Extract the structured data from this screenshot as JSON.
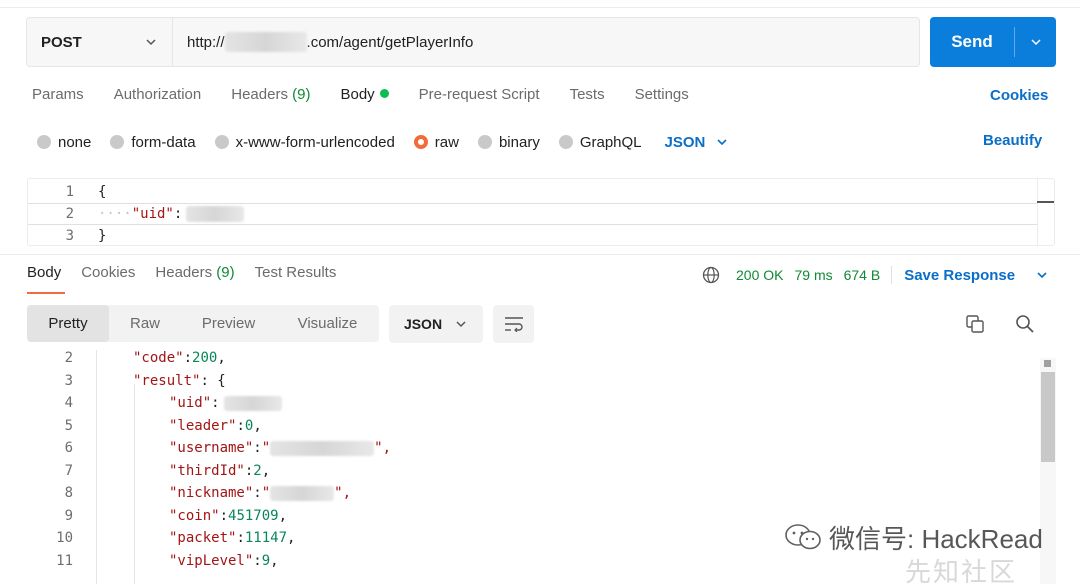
{
  "request": {
    "method": "POST",
    "url_prefix": "http://",
    "url_suffix": ".com/agent/getPlayerInfo",
    "send_label": "Send"
  },
  "request_tabs": [
    {
      "label": "Params"
    },
    {
      "label": "Authorization"
    },
    {
      "label": "Headers",
      "count": "(9)"
    },
    {
      "label": "Body"
    },
    {
      "label": "Pre-request Script"
    },
    {
      "label": "Tests"
    },
    {
      "label": "Settings"
    }
  ],
  "cookies_label": "Cookies",
  "body_types": [
    "none",
    "form-data",
    "x-www-form-urlencoded",
    "raw",
    "binary",
    "GraphQL"
  ],
  "body_format": "JSON",
  "beautify_label": "Beautify",
  "request_body": {
    "lines": [
      {
        "num": "1",
        "text": "{"
      },
      {
        "num": "2",
        "whitespace": "····",
        "key": "\"uid\"",
        "colon": ":"
      },
      {
        "num": "3",
        "text": "}"
      }
    ]
  },
  "response_tabs": [
    {
      "label": "Body"
    },
    {
      "label": "Cookies"
    },
    {
      "label": "Headers",
      "count": "(9)"
    },
    {
      "label": "Test Results"
    }
  ],
  "response_status": {
    "status": "200 OK",
    "time": "79 ms",
    "size": "674 B",
    "save_label": "Save Response"
  },
  "view_modes": [
    "Pretty",
    "Raw",
    "Preview",
    "Visualize"
  ],
  "response_format": "JSON",
  "response_lines": [
    {
      "num": "2",
      "parts": [
        [
          "key",
          "\"code\""
        ],
        [
          "plain",
          ": "
        ],
        [
          "num",
          "200"
        ],
        [
          "plain",
          ","
        ]
      ]
    },
    {
      "num": "3",
      "parts": [
        [
          "key",
          "\"result\""
        ],
        [
          "plain",
          ": {"
        ]
      ]
    },
    {
      "num": "4",
      "parts": [
        [
          "key",
          "\"uid\""
        ],
        [
          "plain",
          ": "
        ]
      ]
    },
    {
      "num": "5",
      "parts": [
        [
          "key",
          "\"leader\""
        ],
        [
          "plain",
          ": "
        ],
        [
          "num",
          "0"
        ],
        [
          "plain",
          ","
        ]
      ]
    },
    {
      "num": "6",
      "parts": [
        [
          "key",
          "\"username\""
        ],
        [
          "plain",
          ": "
        ],
        [
          "key",
          "\""
        ]
      ]
    },
    {
      "num": "7",
      "parts": [
        [
          "key",
          "\"thirdId\""
        ],
        [
          "plain",
          ": "
        ],
        [
          "num",
          "2"
        ],
        [
          "plain",
          ","
        ]
      ]
    },
    {
      "num": "8",
      "parts": [
        [
          "key",
          "\"nickname\""
        ],
        [
          "plain",
          ": "
        ],
        [
          "key",
          "\""
        ]
      ]
    },
    {
      "num": "9",
      "parts": [
        [
          "key",
          "\"coin\""
        ],
        [
          "plain",
          ": "
        ],
        [
          "num",
          "451709"
        ],
        [
          "plain",
          ","
        ]
      ]
    },
    {
      "num": "10",
      "parts": [
        [
          "key",
          "\"packet\""
        ],
        [
          "plain",
          ": "
        ],
        [
          "num",
          "11147"
        ],
        [
          "plain",
          ","
        ]
      ]
    },
    {
      "num": "11",
      "parts": [
        [
          "key",
          "\"vipLevel\""
        ],
        [
          "plain",
          ": "
        ],
        [
          "num",
          "9"
        ],
        [
          "plain",
          ","
        ]
      ]
    }
  ],
  "line6_end": "\",",
  "line8_end": "\",",
  "watermark": {
    "text": "微信号: HackRead",
    "faint": "先知社区"
  },
  "colors": {
    "accent_orange": "#f26b3a",
    "link_blue": "#0b6ec8",
    "send_blue": "#0b7dda",
    "status_green": "#0f8a35",
    "json_key": "#a31515",
    "json_number": "#098658"
  }
}
